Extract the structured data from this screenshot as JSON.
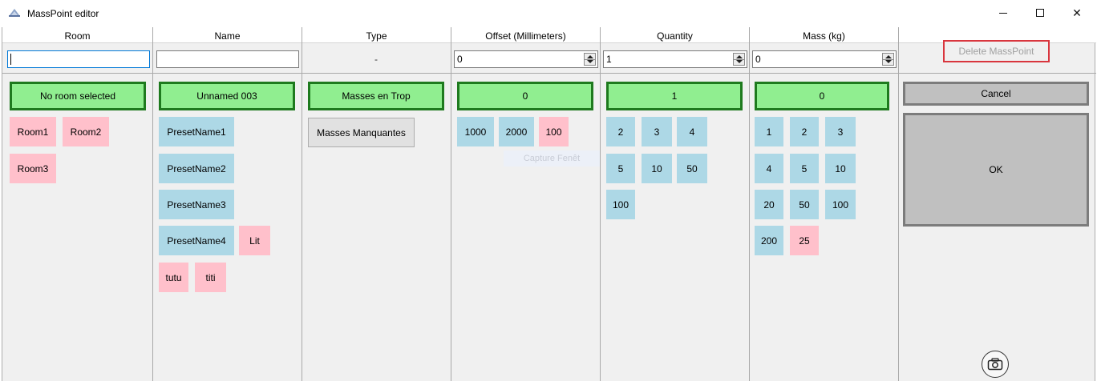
{
  "window": {
    "title": "MassPoint editor",
    "icon": "masspoint-app-icon",
    "minimize_icon": "minimize-icon",
    "maximize_icon": "maximize-icon",
    "close_icon": "close-icon",
    "close_glyph": "✕"
  },
  "columns": [
    {
      "key": "room",
      "header": "Room"
    },
    {
      "key": "name",
      "header": "Name"
    },
    {
      "key": "type",
      "header": "Type"
    },
    {
      "key": "offset",
      "header": "Offset (Millimeters)"
    },
    {
      "key": "quantity",
      "header": "Quantity"
    },
    {
      "key": "mass",
      "header": "Mass (kg)"
    }
  ],
  "filters": {
    "room_value": "",
    "name_value": "",
    "type_value": "-",
    "offset_value": "0",
    "quantity_value": "1",
    "mass_value": "0"
  },
  "delete_button": {
    "label": "Delete MassPoint",
    "state": "disabled",
    "border_color": "#d9363e"
  },
  "selected": {
    "room": "No room selected",
    "name": "Unnamed 003",
    "type": "Masses en Trop",
    "offset": "0",
    "quantity": "1",
    "mass": "0"
  },
  "room_options": [
    {
      "label": "Room1",
      "color": "pink"
    },
    {
      "label": "Room2",
      "color": "pink"
    },
    {
      "label": "Room3",
      "color": "pink"
    }
  ],
  "name_options": [
    {
      "label": "PresetName1",
      "color": "blue"
    },
    {
      "label": "PresetName2",
      "color": "blue"
    },
    {
      "label": "PresetName3",
      "color": "blue"
    },
    {
      "label": "PresetName4",
      "color": "blue"
    },
    {
      "label": "Lit",
      "color": "pink"
    },
    {
      "label": "tutu",
      "color": "pink"
    },
    {
      "label": "titi",
      "color": "pink"
    }
  ],
  "type_options": [
    {
      "label": "Masses Manquantes"
    }
  ],
  "offset_options": [
    {
      "label": "1000",
      "color": "blue"
    },
    {
      "label": "2000",
      "color": "blue"
    },
    {
      "label": "100",
      "color": "pink"
    }
  ],
  "quantity_options": [
    {
      "label": "2",
      "color": "blue"
    },
    {
      "label": "3",
      "color": "blue"
    },
    {
      "label": "4",
      "color": "blue"
    },
    {
      "label": "5",
      "color": "blue"
    },
    {
      "label": "10",
      "color": "blue"
    },
    {
      "label": "50",
      "color": "blue"
    },
    {
      "label": "100",
      "color": "blue"
    }
  ],
  "mass_options": [
    {
      "label": "1",
      "color": "blue"
    },
    {
      "label": "2",
      "color": "blue"
    },
    {
      "label": "3",
      "color": "blue"
    },
    {
      "label": "4",
      "color": "blue"
    },
    {
      "label": "5",
      "color": "blue"
    },
    {
      "label": "10",
      "color": "blue"
    },
    {
      "label": "20",
      "color": "blue"
    },
    {
      "label": "50",
      "color": "blue"
    },
    {
      "label": "100",
      "color": "blue"
    },
    {
      "label": "200",
      "color": "blue"
    },
    {
      "label": "25",
      "color": "pink"
    }
  ],
  "actions": {
    "cancel_label": "Cancel",
    "ok_label": "OK",
    "camera_icon": "camera-icon"
  },
  "overlay": {
    "tooltip_text": "Capture Fenêt"
  },
  "colors": {
    "selected_fill": "#90ee90",
    "selected_border": "#1e7a1e",
    "chip_blue": "#add8e6",
    "chip_pink": "#ffc0cb",
    "action_fill": "#c0c0c0"
  }
}
